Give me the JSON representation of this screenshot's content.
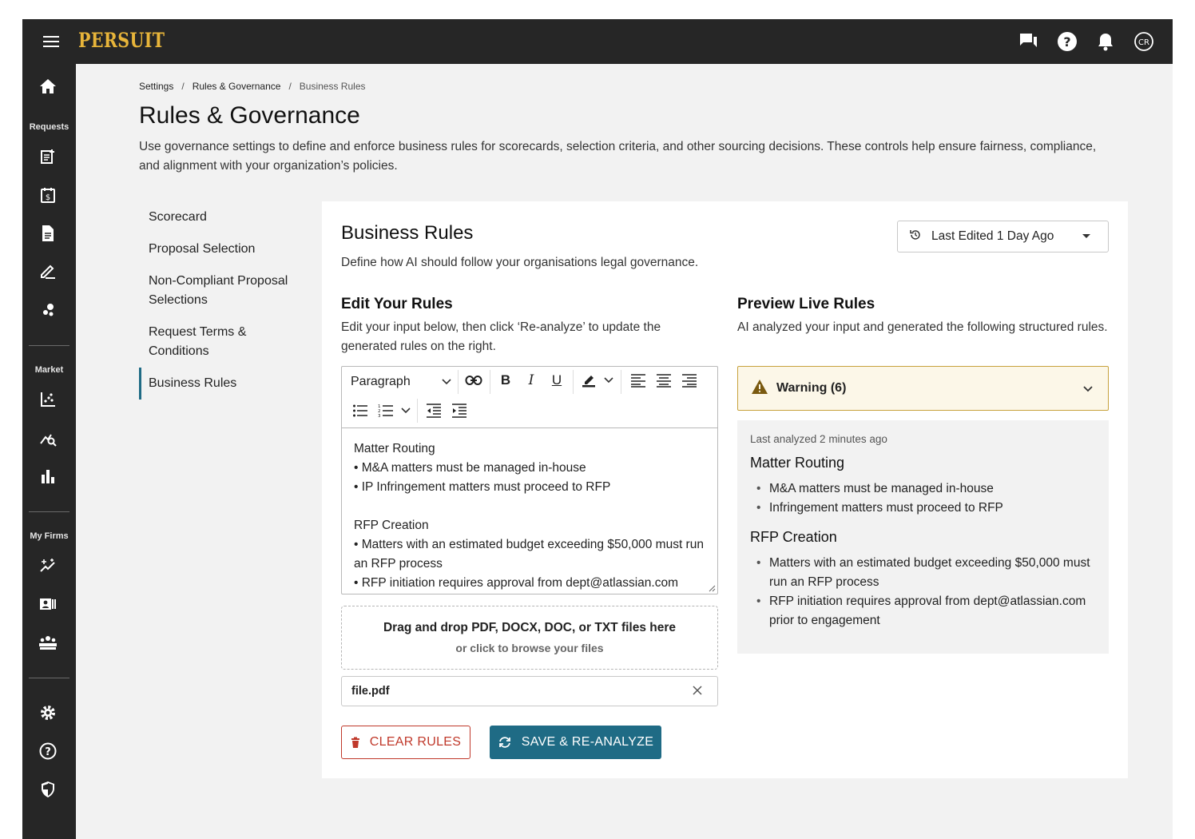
{
  "app": {
    "logo": "PERSUIT"
  },
  "sidebar": {
    "sections": {
      "requests": "Requests",
      "market": "Market",
      "my_firms": "My Firms"
    }
  },
  "topbar": {
    "avatar_initials": "CR"
  },
  "breadcrumb": {
    "items": [
      "Settings",
      "Rules & Governance",
      "Business Rules"
    ],
    "separator": "/"
  },
  "page": {
    "title": "Rules & Governance",
    "description": "Use governance settings to define and enforce business rules for scorecards, selection criteria, and other sourcing decisions. These controls help ensure fairness, compliance, and alignment with your organization’s policies."
  },
  "leftnav": {
    "items": [
      {
        "label": "Scorecard"
      },
      {
        "label": "Proposal Selection"
      },
      {
        "label": "Non-Compliant Proposal Selections"
      },
      {
        "label": "Request Terms & Conditions"
      },
      {
        "label": "Business Rules",
        "active": true
      }
    ]
  },
  "card": {
    "title": "Business Rules",
    "subtitle": "Define how AI should follow your organisations legal governance.",
    "last_edited": "Last Edited 1 Day Ago"
  },
  "edit": {
    "title": "Edit Your Rules",
    "description": "Edit your input below, then click ‘Re-analyze’ to update the generated rules on the right.",
    "paragraph_select": "Paragraph",
    "content": "Matter Routing\n• M&A matters must be managed in-house\n• IP Infringement matters must proceed to RFP\n\nRFP Creation\n• Matters with an estimated budget exceeding $50,000 must run an RFP process\n• RFP initiation requires approval from dept@atlassian.com",
    "dropzone_title": "Drag and drop PDF, DOCX, DOC, or TXT files here",
    "dropzone_sub": "or click to browse your files",
    "file_name": "file.pdf",
    "clear_label": "CLEAR RULES",
    "save_label": "SAVE & RE-ANALYZE"
  },
  "preview": {
    "title": "Preview Live Rules",
    "description": "AI analyzed your input and generated the following structured rules.",
    "warning_label": "Warning (6)",
    "last_analyzed": "Last analyzed 2 minutes ago",
    "groups": [
      {
        "heading": "Matter Routing",
        "items": [
          "M&A matters must be managed in-house",
          "Infringement matters must proceed to RFP"
        ]
      },
      {
        "heading": "RFP Creation",
        "items": [
          "Matters with an estimated budget exceeding $50,000 must run an RFP process",
          "RFP initiation requires approval from dept@atlassian.com prior to engagement"
        ]
      }
    ]
  },
  "colors": {
    "topbar": "#262626",
    "logo": "#e8b53a",
    "accent": "#1f6b85",
    "danger": "#c0392b",
    "warning_border": "#c7a23d",
    "warning_bg": "#fcf7e8",
    "warning_icon": "#7a5a10"
  }
}
